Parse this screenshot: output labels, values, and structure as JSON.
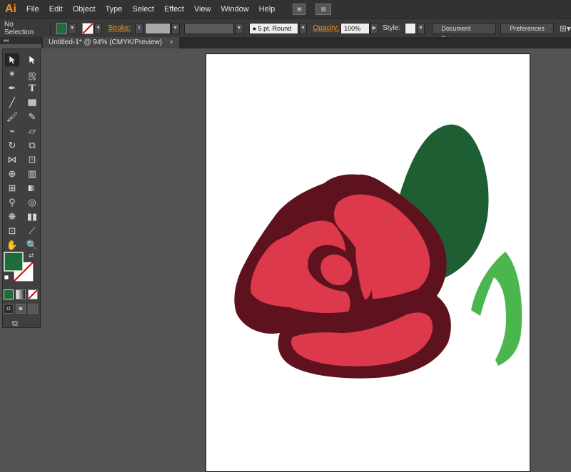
{
  "app": {
    "logo": "Ai"
  },
  "menu": [
    "File",
    "Edit",
    "Object",
    "Type",
    "Select",
    "Effect",
    "View",
    "Window",
    "Help"
  ],
  "control_bar": {
    "selection_label": "No Selection",
    "stroke_label": "Stroke:",
    "brush_value": "5 pt. Round",
    "opacity_label": "Opacity:",
    "opacity_value": "100%",
    "style_label": "Style:",
    "document_setup": "Document Setup",
    "preferences": "Preferences"
  },
  "document_tab": {
    "title": "Untitled-1* @ 94% (CMYK/Preview)",
    "close": "×"
  },
  "colors": {
    "fill": "#1e6b3c",
    "rose_outline": "#5e121d",
    "rose_petal": "#dc394d",
    "leaf": "#1e5e33",
    "stem_leaf": "#4cb64e"
  },
  "tools": [
    [
      "selection-tool",
      "direct-selection-tool"
    ],
    [
      "magic-wand-tool",
      "lasso-tool"
    ],
    [
      "pen-tool",
      "type-tool"
    ],
    [
      "line-segment-tool",
      "rectangle-tool"
    ],
    [
      "paintbrush-tool",
      "pencil-tool"
    ],
    [
      "blob-brush-tool",
      "eraser-tool"
    ],
    [
      "rotate-tool",
      "scale-tool"
    ],
    [
      "width-tool",
      "free-transform-tool"
    ],
    [
      "shape-builder-tool",
      "perspective-grid-tool"
    ],
    [
      "mesh-tool",
      "gradient-tool"
    ],
    [
      "eyedropper-tool",
      "blend-tool"
    ],
    [
      "symbol-sprayer-tool",
      "column-graph-tool"
    ],
    [
      "artboard-tool",
      "slice-tool"
    ],
    [
      "hand-tool",
      "zoom-tool"
    ]
  ]
}
